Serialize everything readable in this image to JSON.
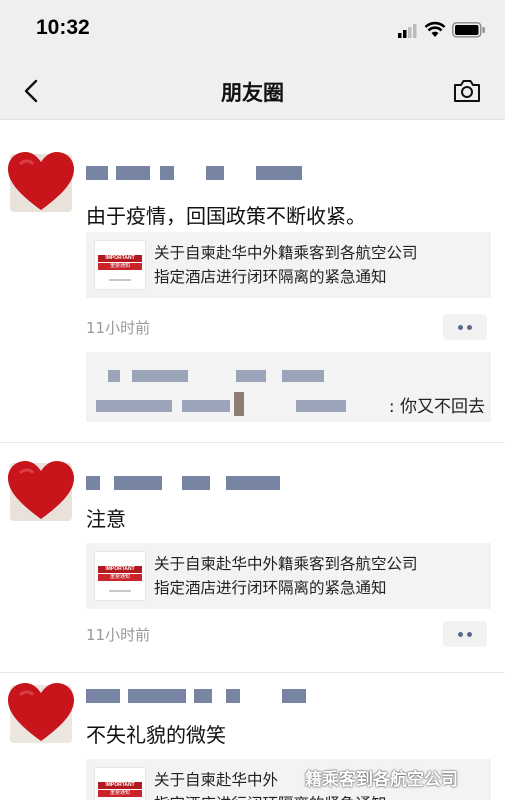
{
  "status_bar": {
    "time": "10:32"
  },
  "nav": {
    "title": "朋友圈",
    "back_icon": "chevron-left-icon",
    "camera_icon": "camera-icon"
  },
  "posts": [
    {
      "text": "由于疫情，回国政策不断收紧。",
      "link_title_1": "关于自柬赴华中外籍乘客到各航空公司",
      "link_title_2": "指定酒店进行闭环隔离的紧急通知",
      "thumb_tag": "IMPORTANT",
      "thumb_cn": "重要通知",
      "time_ago": "11小时前",
      "comment_tail": ": 你又不回去"
    },
    {
      "text": "注意",
      "link_title_1": "关于自柬赴华中外籍乘客到各航空公司",
      "link_title_2": "指定酒店进行闭环隔离的紧急通知",
      "thumb_tag": "IMPORTANT",
      "thumb_cn": "重要通知",
      "time_ago": "11小时前"
    },
    {
      "text": "不失礼貌的微笑",
      "link_title_1": "关于自柬赴华中外",
      "link_title_2": "指定酒店进行闭环隔离的紧急通知",
      "thumb_tag": "IMPORTANT",
      "thumb_cn": "重要通知"
    }
  ],
  "watermark": "籍乘客到各航空公司",
  "colors": {
    "heart": "#c8141b",
    "nav_bg": "#efefef",
    "card_bg": "#f3f3f3",
    "name_link": "#5b6b8c"
  }
}
